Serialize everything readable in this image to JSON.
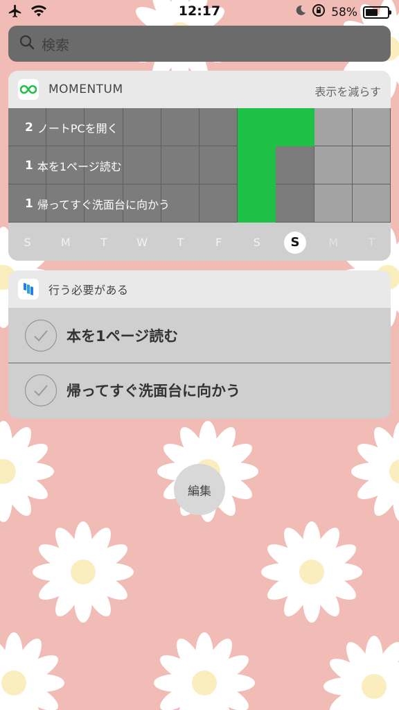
{
  "status_bar": {
    "time": "12:17",
    "battery": "58%",
    "battery_level": 0.58,
    "icons": [
      "airplane-icon",
      "wifi-icon",
      "moon-icon",
      "rotation-lock-icon",
      "battery-icon"
    ]
  },
  "search": {
    "placeholder": "検索",
    "icon": "search-icon"
  },
  "momentum": {
    "title": "MOMENTUM",
    "action": "表示を減らす",
    "accent": "#1ec046",
    "habits": [
      {
        "count": "2",
        "name": "ノートPCを開く",
        "done": [
          false,
          false,
          false,
          false,
          false,
          false,
          true,
          true,
          false,
          false
        ]
      },
      {
        "count": "1",
        "name": "本を1ページ読む",
        "done": [
          false,
          false,
          false,
          false,
          false,
          false,
          true,
          false,
          false,
          false
        ]
      },
      {
        "count": "1",
        "name": "帰ってすぐ洗面台に向かう",
        "done": [
          false,
          false,
          false,
          false,
          false,
          false,
          true,
          false,
          false,
          false
        ]
      }
    ],
    "days": [
      "S",
      "M",
      "T",
      "W",
      "T",
      "F",
      "S",
      "S",
      "M",
      "T"
    ],
    "today_index": 7
  },
  "todo": {
    "title": "行う必要がある",
    "items": [
      {
        "label": "本を1ページ読む"
      },
      {
        "label": "帰ってすぐ洗面台に向かう"
      }
    ]
  },
  "edit_label": "編集"
}
